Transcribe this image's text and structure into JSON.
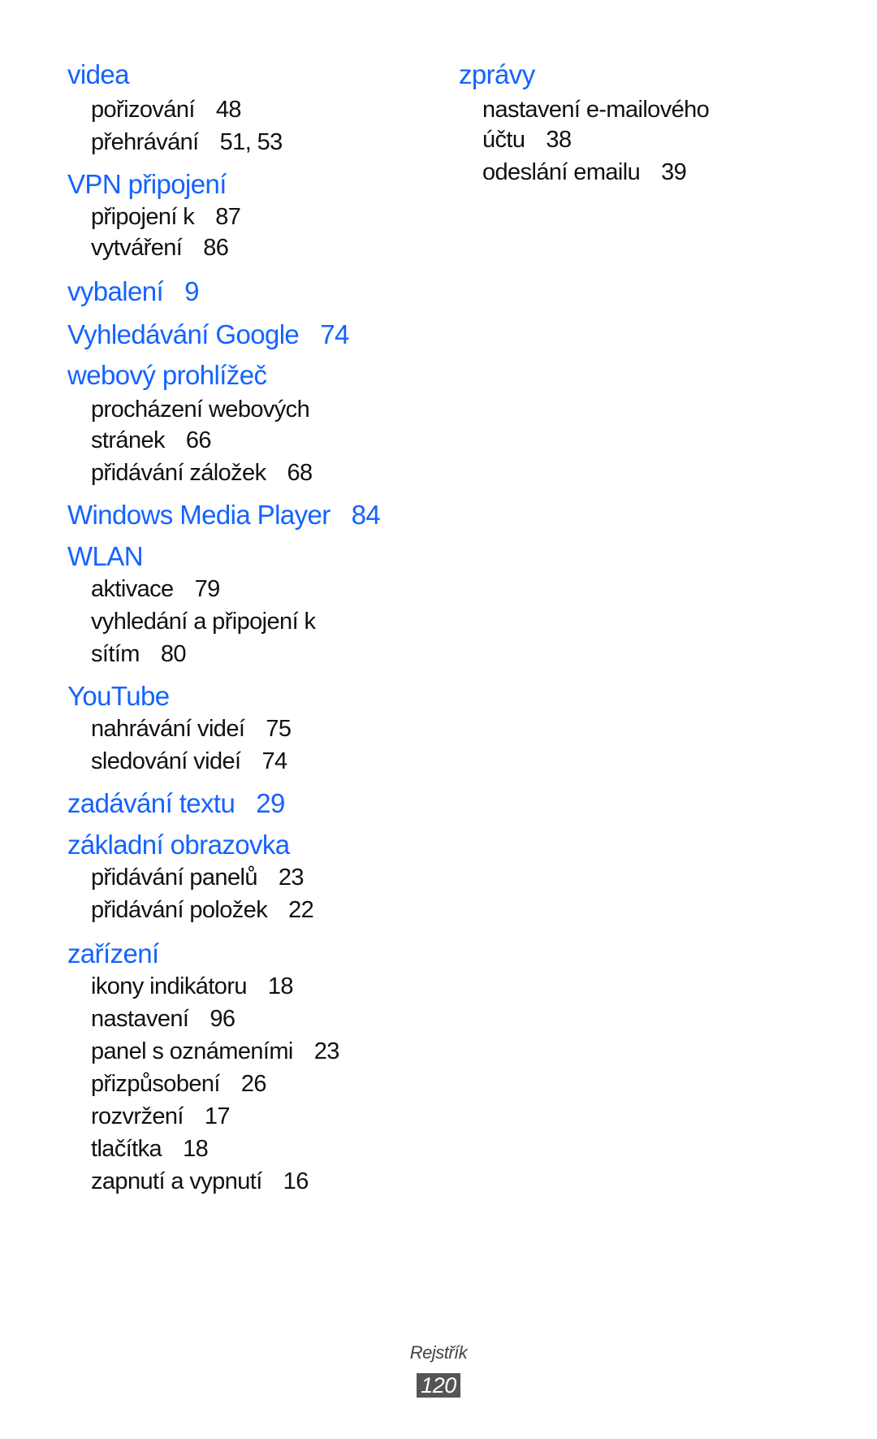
{
  "left_column": [
    {
      "type": "head",
      "term": "videa",
      "pages": ""
    },
    {
      "type": "sub",
      "term": "pořizování",
      "pages": "48"
    },
    {
      "type": "sub",
      "term": "přehrávání",
      "pages": "51, 53"
    },
    {
      "type": "head",
      "term": "VPN připojení",
      "pages": ""
    },
    {
      "type": "sub",
      "term": "připojení k",
      "pages": "87"
    },
    {
      "type": "sub",
      "term": "vytváření",
      "pages": "86"
    },
    {
      "type": "head",
      "term": "vybalení",
      "pages": "9"
    },
    {
      "type": "head",
      "term": "Vyhledávání Google",
      "pages": "74"
    },
    {
      "type": "head",
      "term": "webový prohlížeč",
      "pages": ""
    },
    {
      "type": "sub",
      "term": "procházení webových",
      "pages": ""
    },
    {
      "type": "sub",
      "term": "stránek",
      "pages": "66"
    },
    {
      "type": "sub",
      "term": "přidávání záložek",
      "pages": "68"
    },
    {
      "type": "head",
      "term": "Windows Media Player",
      "pages": "84"
    },
    {
      "type": "head",
      "term": "WLAN",
      "pages": ""
    },
    {
      "type": "sub",
      "term": "aktivace",
      "pages": "79"
    },
    {
      "type": "sub",
      "term": "vyhledání a připojení k",
      "pages": ""
    },
    {
      "type": "sub",
      "term": "sítím",
      "pages": "80"
    },
    {
      "type": "head",
      "term": "YouTube",
      "pages": ""
    },
    {
      "type": "sub",
      "term": "nahrávání videí",
      "pages": "75"
    },
    {
      "type": "sub",
      "term": "sledování videí",
      "pages": "74"
    },
    {
      "type": "head",
      "term": "zadávání textu",
      "pages": "29"
    },
    {
      "type": "head",
      "term": "základní obrazovka",
      "pages": ""
    },
    {
      "type": "sub",
      "term": "přidávání panelů",
      "pages": "23"
    },
    {
      "type": "sub",
      "term": "přidávání položek",
      "pages": "22"
    },
    {
      "type": "head",
      "term": "zařízení",
      "pages": ""
    },
    {
      "type": "sub",
      "term": "ikony indikátoru",
      "pages": "18"
    },
    {
      "type": "sub",
      "term": "nastavení",
      "pages": "96"
    },
    {
      "type": "sub",
      "term": "panel s oznámeními",
      "pages": "23"
    },
    {
      "type": "sub",
      "term": "přizpůsobení",
      "pages": "26"
    },
    {
      "type": "sub",
      "term": "rozvržení",
      "pages": "17"
    },
    {
      "type": "sub",
      "term": "tlačítka",
      "pages": "18"
    },
    {
      "type": "sub",
      "term": "zapnutí a vypnutí",
      "pages": "16"
    }
  ],
  "right_column": [
    {
      "type": "head",
      "term": "zprávy",
      "pages": ""
    },
    {
      "type": "sub",
      "term": "nastavení e-mailového",
      "pages": ""
    },
    {
      "type": "sub",
      "term": "účtu",
      "pages": "38"
    },
    {
      "type": "sub",
      "term": "odeslání emailu",
      "pages": "39"
    }
  ],
  "footer": {
    "section_label": "Rejstřík",
    "page_number": "120"
  },
  "colors": {
    "heading": "#1463ff",
    "text": "#111111",
    "page_badge": "#555555"
  }
}
